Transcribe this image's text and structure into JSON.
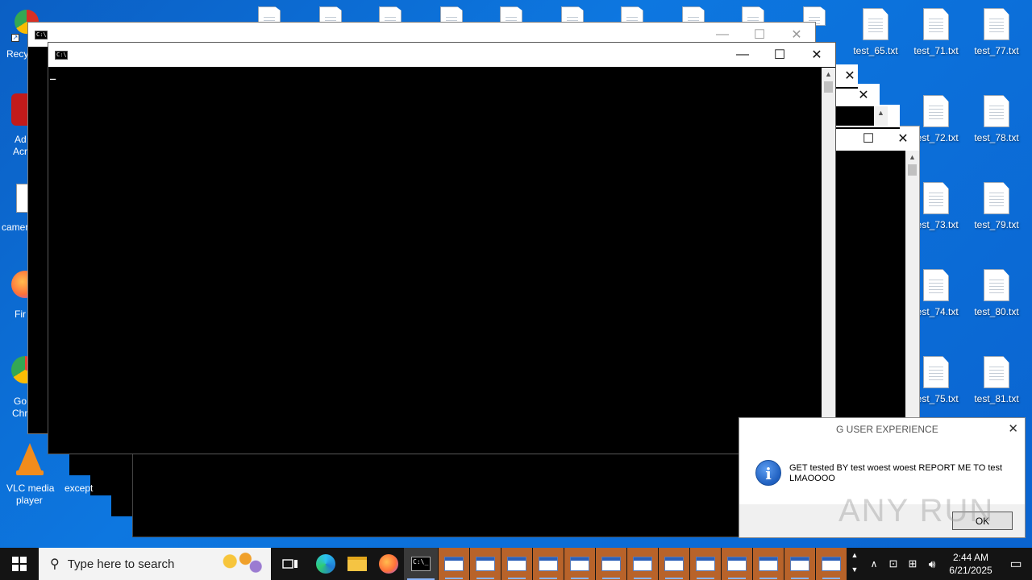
{
  "desktop": {
    "left_icons": [
      {
        "label": "Recycle",
        "color": "#d93025"
      },
      {
        "label": "Adobe Acrobat",
        "color": "#c21b1b"
      },
      {
        "label": "camera",
        "color": "#e8e8e8"
      },
      {
        "label": "Firefox",
        "color": "#ff7139"
      },
      {
        "label": "Google Chrome",
        "color": "#34a853"
      }
    ],
    "left_text": {
      "recycle": "Recy",
      "adobe1": "Ad",
      "adobe2": "Acr",
      "camera": "camer",
      "firefox": "Fir",
      "chrome1": "Go",
      "chrome2": "Chr",
      "vlc1": "VLC media",
      "vlc2": "player",
      "except": "except"
    },
    "files_col1": [
      "test_65.txt"
    ],
    "files_col2": [
      "test_71.txt",
      "test_72.txt",
      "test_73.txt",
      "test_74.txt",
      "test_75.txt"
    ],
    "files_col3": [
      "test_77.txt",
      "test_78.txt",
      "test_79.txt",
      "test_80.txt",
      "test_81.txt"
    ]
  },
  "cmd_window": {
    "icon": "cmd-icon",
    "cursor": "_"
  },
  "message_box": {
    "title": "G USER EXPERIENCE",
    "message": "GET tested BY test woest woest REPORT ME TO test LMAOOOO",
    "ok_label": "OK",
    "icon": "info-icon"
  },
  "watermark": "ANY RUN",
  "taskbar": {
    "search_placeholder": "Type here to search",
    "time": "2:44 AM",
    "date": "6/21/2025",
    "open_window_count_label": ""
  }
}
